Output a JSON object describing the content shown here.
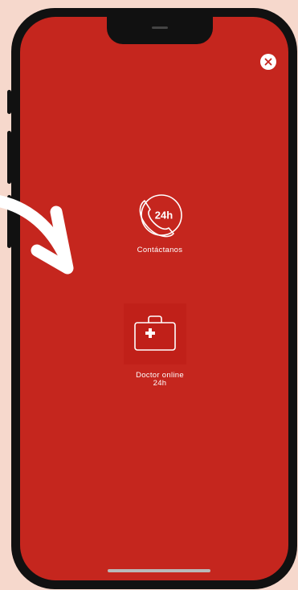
{
  "header": {
    "close_icon": "close-icon"
  },
  "menu": {
    "contact": {
      "icon": "phone-24h-icon",
      "badge": "24h",
      "label": "Contáctanos"
    },
    "doctor": {
      "icon": "medical-kit-icon",
      "label_line1": "Doctor online",
      "label_line2": "24h"
    }
  },
  "colors": {
    "background": "#c5261e",
    "page": "#f6d8cc",
    "frame": "#111111",
    "foreground": "#ffffff"
  }
}
